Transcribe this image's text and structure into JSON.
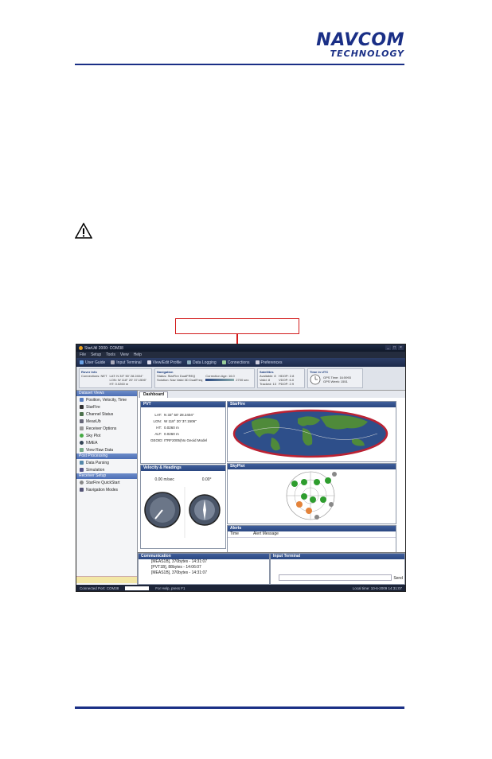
{
  "header": {
    "logo_line1": "NAVCOM",
    "logo_line2": "TECHNOLOGY"
  },
  "app": {
    "title": "StarUtil 2000: COM38",
    "menu": [
      "File",
      "Setup",
      "Tools",
      "View",
      "Help"
    ],
    "toolbar": [
      "User Guide",
      "Input Terminal",
      "View/Edit Profile",
      "Data Logging",
      "Connections",
      "Preferences"
    ],
    "info": {
      "rover": {
        "title": "Rover Info",
        "connections_label": "Connections: NET",
        "lat": "LAT: N 33° 50' 28.2404\"",
        "lon": "LON: W 118° 20' 37.1506\"",
        "hgt": "HT: 0.0260 m"
      },
      "navigation": {
        "title": "Navigation",
        "status": "Status: StarFire DualFREQ",
        "solution": "Solution: Nav Valid 3D DualFreq",
        "correction_age": "Correction Age: 16.0",
        "ages": "2700 sec"
      },
      "satellites": {
        "title": "Satellites",
        "available": "Available: 8",
        "valid": "Valid: 8",
        "tracked": "Tracked: 13",
        "hdop": "HDOP: 2.8",
        "vdop": "VDOP: 6.0",
        "pdop": "PDOP: 2.9"
      },
      "time": {
        "title": "Time in UTC",
        "gps_time": "GPS Time: 16:5993",
        "gps_week": "GPS Week: 1551"
      }
    },
    "sidebar": {
      "sections": [
        {
          "title": "Dataset Views",
          "items": [
            "Position, Velocity, Time",
            "StarFire",
            "Channel Status",
            "MeasUb",
            "Receiver Options",
            "Sky Plot",
            "NMEA",
            "View Raw Data"
          ]
        },
        {
          "title": "Post Processing",
          "items": [
            "Data Parsing",
            "Simulation"
          ]
        },
        {
          "title": "Receiver Setup",
          "items": [
            "StarFire QuickStart",
            "Navigation Modes"
          ]
        }
      ]
    },
    "tab": "Dashboard",
    "pvt": {
      "title": "PVT",
      "lat_k": "LAT:",
      "lat_v": "N 33° 50' 28.2404\"",
      "lon_k": "LON:",
      "lon_v": "W 118° 20' 37.1506\"",
      "hgt_k": "HT:",
      "hgt_v": "0.0260 m",
      "alt_k": "ALT:",
      "alt_v": "0.0260 m",
      "geoid_k": "GEOID:",
      "geoid_v": "ITRF2005(No Geoid Model"
    },
    "starfire_title": "StarFire",
    "velocity": {
      "title": "Velocity & Headings",
      "speed": "0.00 m/sec",
      "heading": "0.00°"
    },
    "skyplot_title": "SkyPlot",
    "alerts": {
      "title": "Alerts",
      "col_time": "Time",
      "col_msg": "Alert Message"
    },
    "communication": {
      "title": "Communication",
      "logs": [
        "[MEAS1B], 370bytes - 14:31:07",
        "[PVT1B], 88bytes - 14:06:07",
        "[MEAS1B], 370bytes - 14:31:07"
      ]
    },
    "terminal": {
      "title": "Input Terminal",
      "send": "Send"
    },
    "status": {
      "port": "Connected Port: COM38",
      "help": "For Help, press F1",
      "local_time": "Local time: 10-6-2009 14:31:07"
    }
  }
}
